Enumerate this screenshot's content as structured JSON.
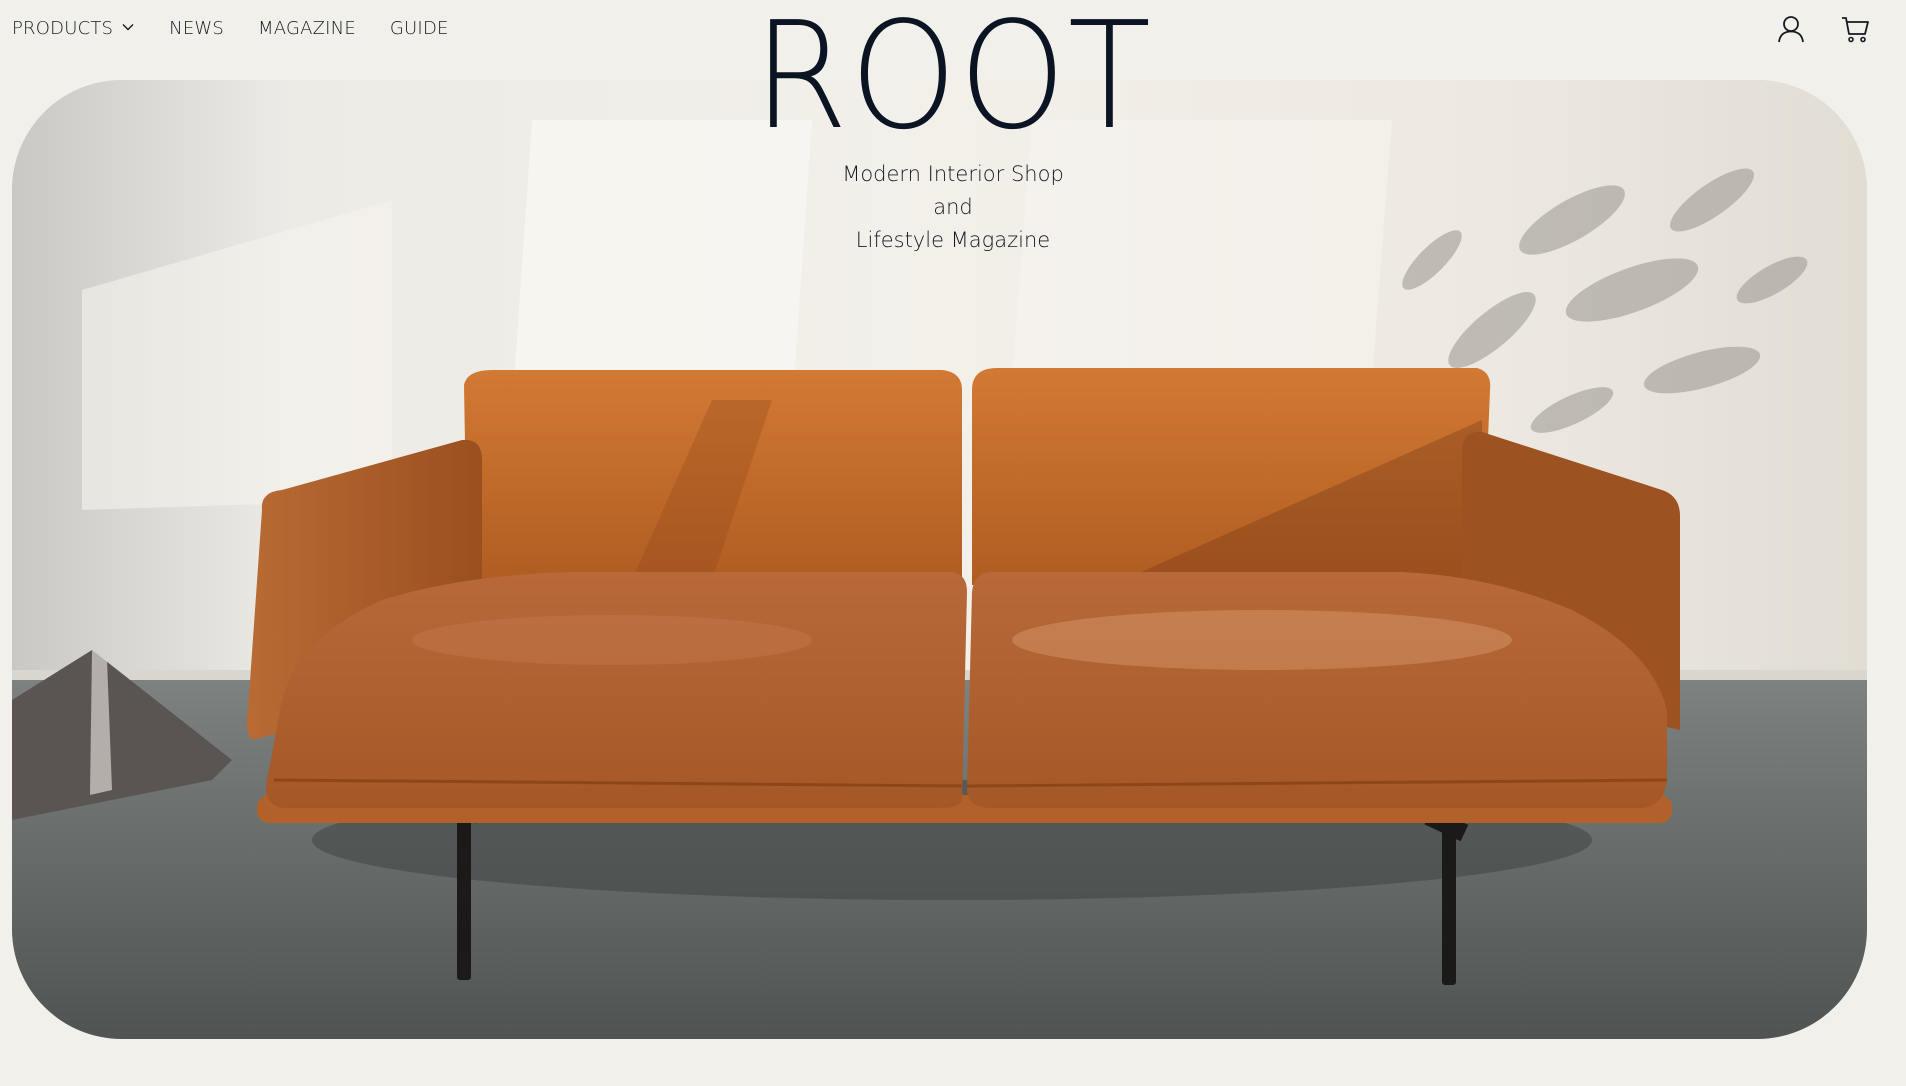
{
  "nav": {
    "items": [
      {
        "label": "PRODUCTS",
        "has_dropdown": true,
        "icon": "chevron-down-icon"
      },
      {
        "label": "NEWS"
      },
      {
        "label": "MAGAZINE"
      },
      {
        "label": "GUIDE"
      }
    ],
    "actions": [
      {
        "icon": "user-icon"
      },
      {
        "icon": "cart-icon"
      }
    ]
  },
  "brand": {
    "logo": "ROOT",
    "tagline_line1": "Modern Interior Shop",
    "tagline_line2": "and",
    "tagline_line3": "Lifestyle Magazine"
  },
  "hero": {
    "image": "leather-sofa-photo",
    "colors": {
      "wall": "#ebe8e2",
      "floor": "#5d6160",
      "sofa": "#b8652a"
    }
  },
  "colors": {
    "background": "#f2f0ea",
    "text": "#0b1423"
  }
}
